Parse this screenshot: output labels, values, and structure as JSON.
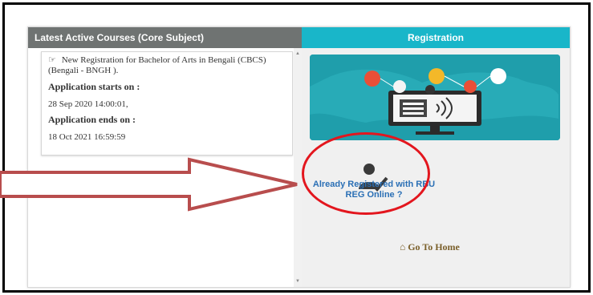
{
  "left_panel": {
    "header": "Latest Active Courses (Core Subject)",
    "course": {
      "title": "New Registration for Bachelor of Arts in Bengali (CBCS) (Bengali - BNGH ).",
      "starts_label": "Application starts on :",
      "starts_value": "28 Sep 2020 14:00:01,",
      "ends_label": "Application ends on :",
      "ends_value": "18 Oct 2021 16:59:59"
    }
  },
  "right_panel": {
    "header": "Registration",
    "already_registered_line1": "Already Registered with RBU",
    "already_registered_line2": "REG Online ?",
    "home_link": "Go To Home"
  },
  "icons": {
    "course_bullet": "hand-pointer-icon",
    "home": "home-icon",
    "user": "user-check-icon"
  },
  "colors": {
    "left_header": "#6f7372",
    "right_header": "#19b6c9",
    "highlight": "#e3161e",
    "arrow": "#b84d4d",
    "link": "#2a6fb5",
    "home_link": "#7a5f2a"
  }
}
